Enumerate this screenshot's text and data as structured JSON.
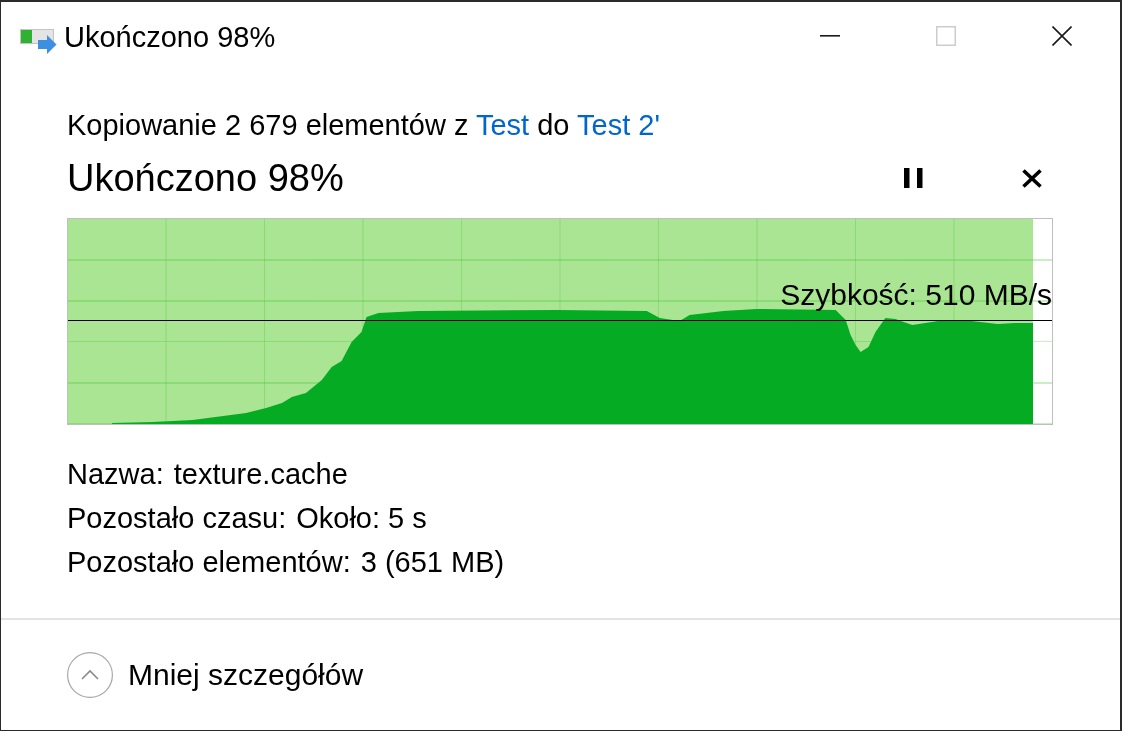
{
  "window": {
    "title": "Ukończono 98%",
    "controls": [
      {
        "kind": "minimize",
        "disabled": false
      },
      {
        "kind": "maximize",
        "disabled": true
      },
      {
        "kind": "close",
        "disabled": false
      }
    ]
  },
  "summary": {
    "parts": [
      {
        "kind": "text",
        "text": "Kopiowanie 2 679 elementów z "
      },
      {
        "kind": "link",
        "text": "Test"
      },
      {
        "kind": "text",
        "text": " do "
      },
      {
        "kind": "link",
        "text": "Test 2'"
      }
    ]
  },
  "status": {
    "heading": "Ukończono 98%"
  },
  "progress": {
    "level": 0.98,
    "speed": "Szybkość: 510 MB/s"
  },
  "details": [
    {
      "label": "Nazwa:",
      "value": "texture.cache"
    },
    {
      "label": "Pozostało czasu:",
      "value": "Około: 5 s"
    },
    {
      "label": "Pozostało elementów:",
      "value": "3 (651 MB)"
    }
  ],
  "footer": {
    "toggle": "Mniej szczegółów",
    "expanded": true
  }
}
